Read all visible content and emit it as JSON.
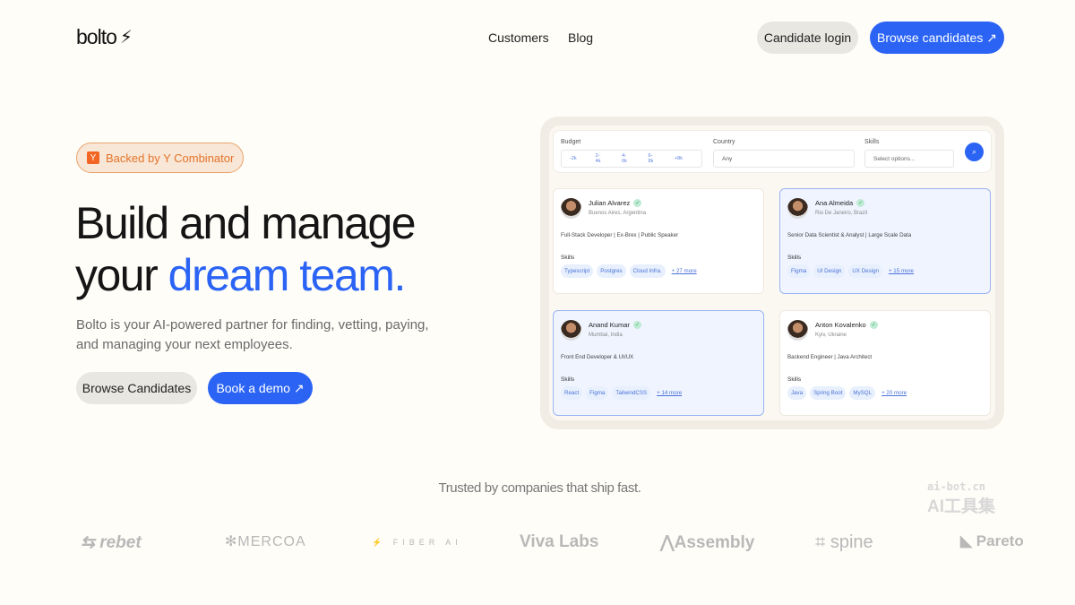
{
  "brand": {
    "name": "bolto"
  },
  "nav": {
    "links": [
      "Customers",
      "Blog"
    ],
    "candidate_login": "Candidate login",
    "browse": "Browse candidates ↗"
  },
  "hero": {
    "badge": "Backed by Y Combinator",
    "badge_icon": "Y",
    "title_line1": "Build and manage",
    "title_line2_a": "your ",
    "title_line2_b": "dream team.",
    "subtitle": "Bolto is your AI-powered partner for finding, vetting, paying, and managing your next employees.",
    "btn_browse": "Browse Candidates",
    "btn_demo": "Book a demo ↗"
  },
  "filters": {
    "budget_label": "Budget",
    "budget_options": [
      "-2k",
      "2-4k",
      "4-6k",
      "6-8k",
      "+8k"
    ],
    "country_label": "Country",
    "country_value": "Any",
    "skills_label": "Skills",
    "skills_placeholder": "Select options..."
  },
  "candidates": [
    {
      "name": "Julian Alvarez",
      "location": "Buenos Aires, Argentina",
      "role": "Full-Stack Developer | Ex-Brex | Public Speaker",
      "skills": [
        "Typescript",
        "Postgres",
        "Cloud Infra."
      ],
      "more": "+ 27 more",
      "selected": false
    },
    {
      "name": "Ana Almeida",
      "location": "Rio De Janeiro, Brazil",
      "role": "Senior Data Scientist & Analyst | Large Scale Data",
      "skills": [
        "Figma",
        "UI Design",
        "UX Design"
      ],
      "more": "+ 15 more",
      "selected": true
    },
    {
      "name": "Anand Kumar",
      "location": "Mumbai, India",
      "role": "Front End Developer & UI/UX",
      "skills": [
        "React",
        "Figma",
        "TailwindCSS"
      ],
      "more": "+ 14 more",
      "selected": true
    },
    {
      "name": "Anton Kovalenko",
      "location": "Kyiv, Ukraine",
      "role": "Backend Engineer | Java Architect",
      "skills": [
        "Java",
        "Spring Boot",
        "MySQL"
      ],
      "more": "+ 20 more",
      "selected": false
    }
  ],
  "skills_label": "Skills",
  "trusted": "Trusted by companies that ship fast.",
  "logos": [
    "rebet",
    "MERCOA",
    "FIBER AI",
    "Viva Labs",
    "Assembly",
    "spine",
    "Pareto"
  ],
  "watermark": {
    "line1": "ai-bot.cn",
    "line2": "AI工具集"
  },
  "colors": {
    "accent": "#2b64f5",
    "badge": "#e4742a"
  }
}
